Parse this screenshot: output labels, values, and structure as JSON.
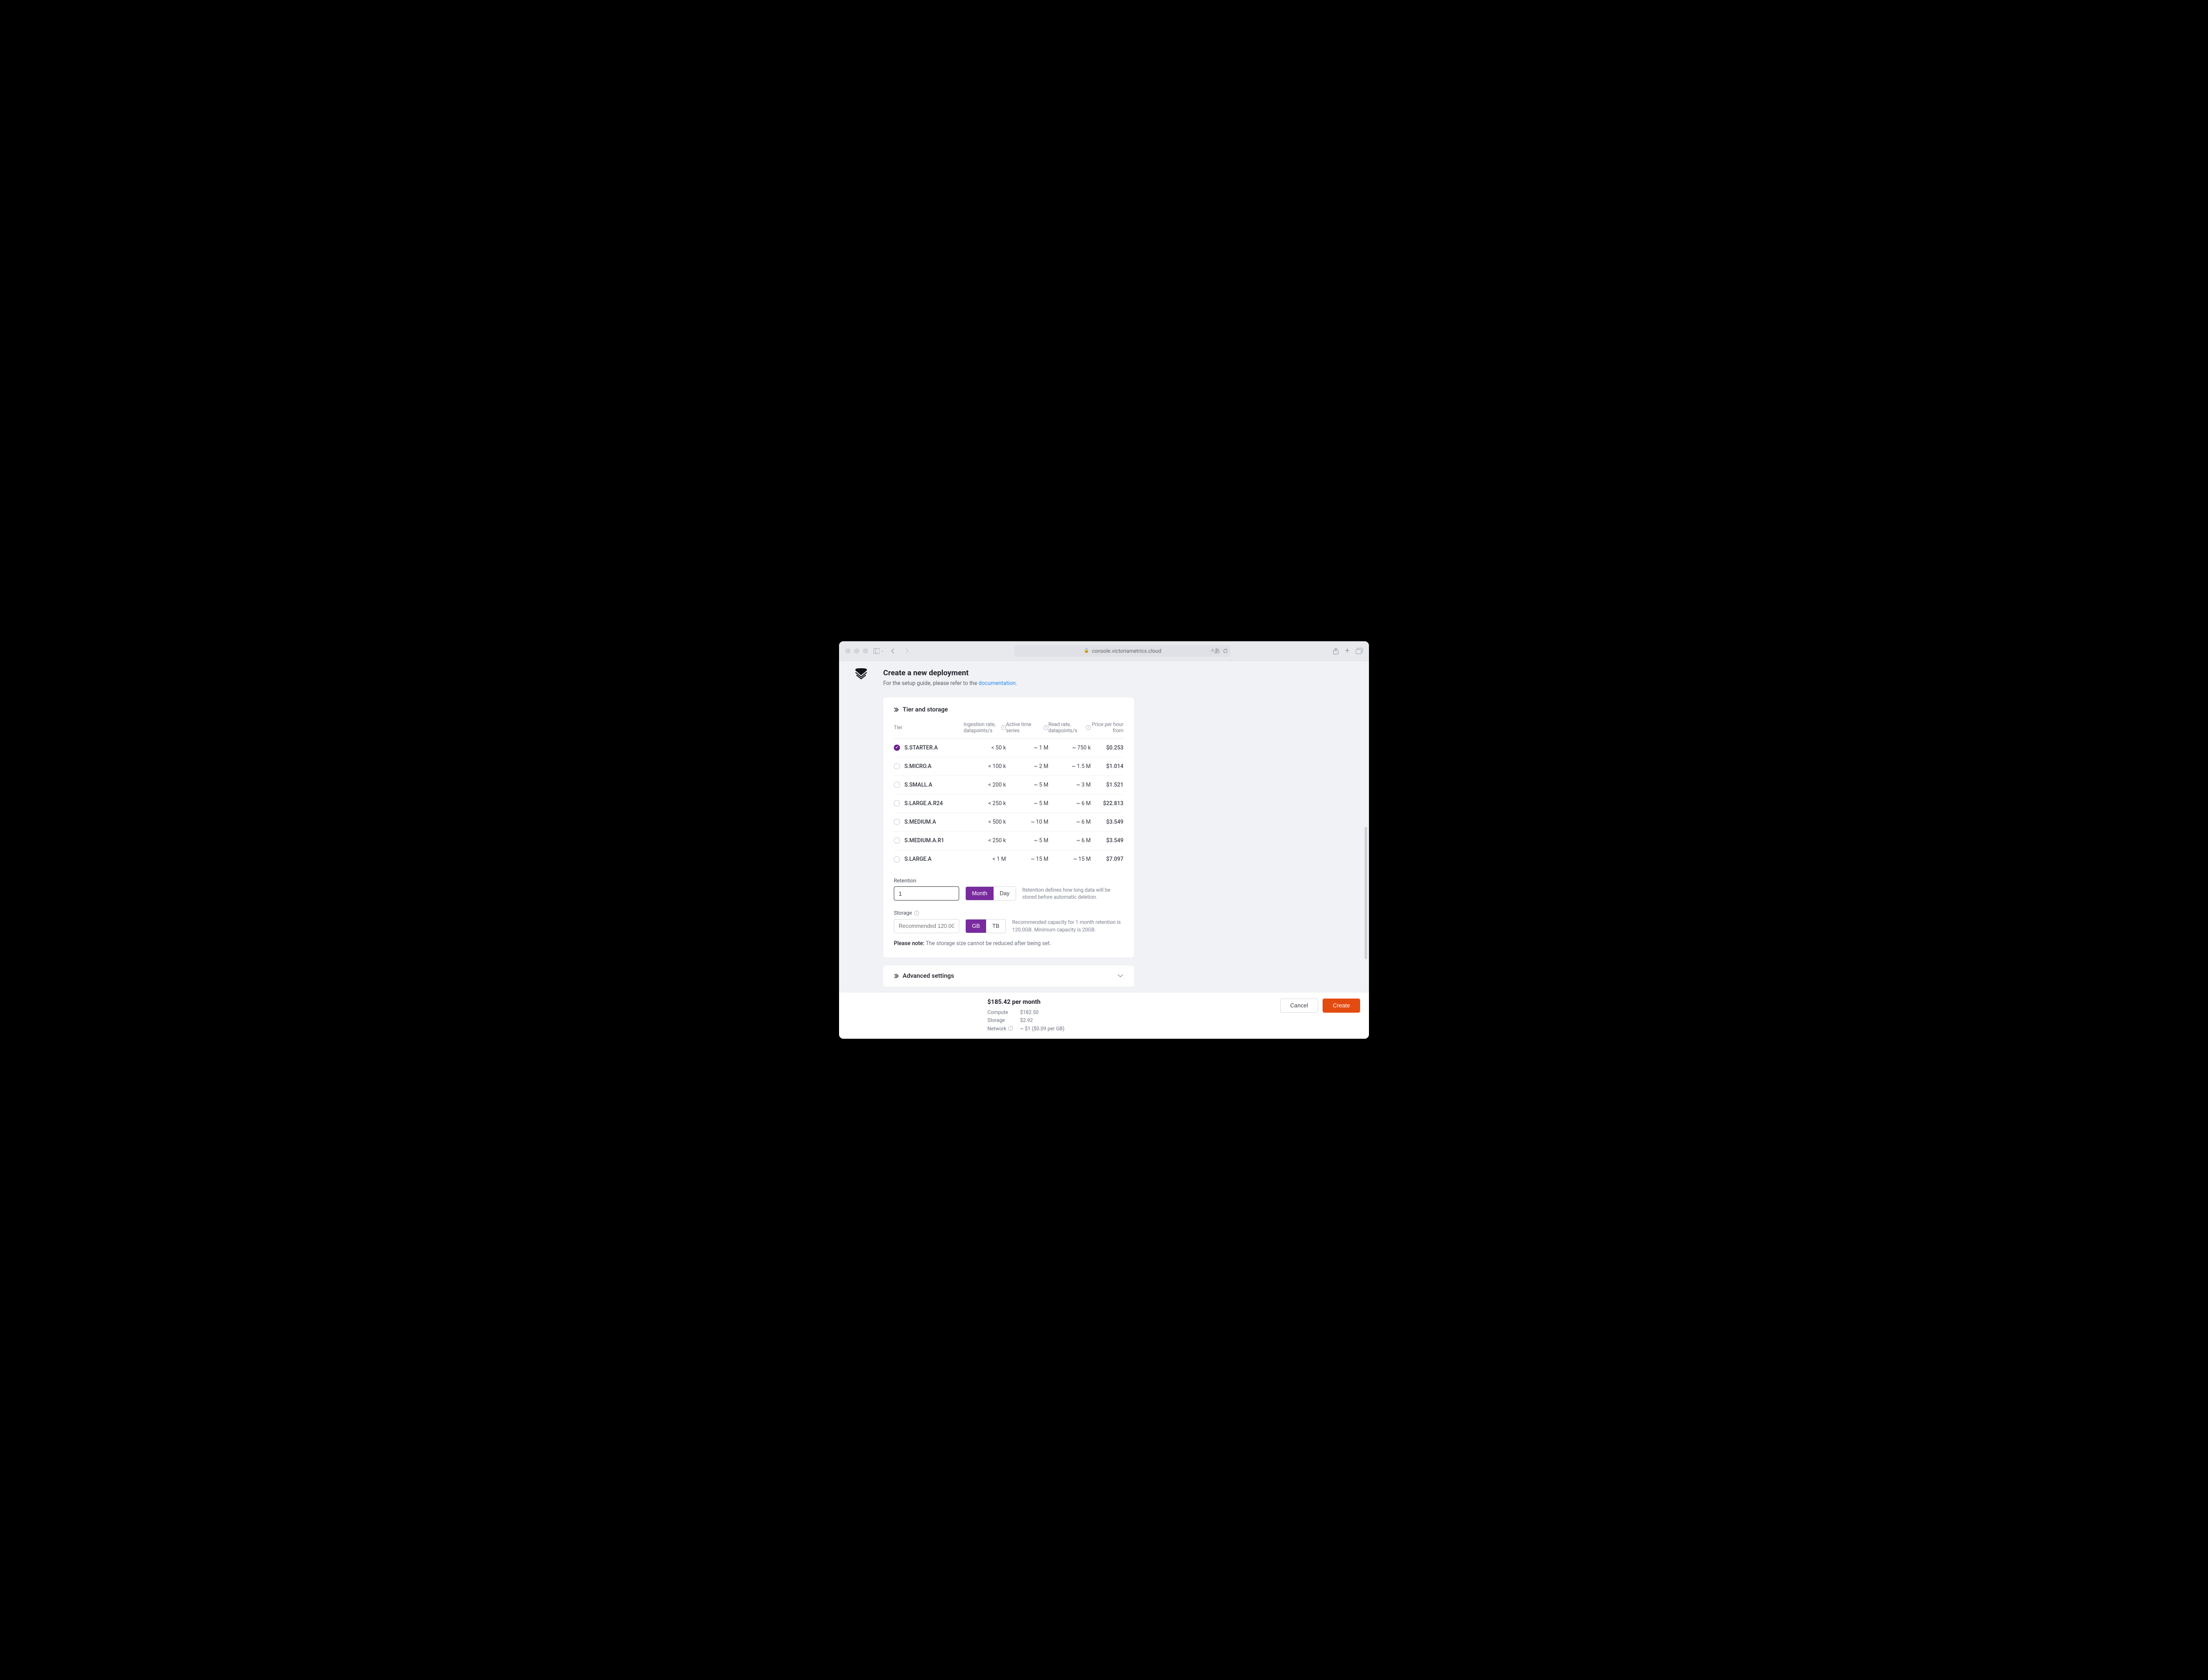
{
  "browser": {
    "url": "console.victoriametrics.cloud"
  },
  "header": {
    "title": "Create a new deployment",
    "subtitle_prefix": "For the setup guide, please refer to the ",
    "doc_link": "documentation",
    "subtitle_suffix": "."
  },
  "tier_section": {
    "heading": "Tier and storage",
    "columns": {
      "tier": "Tier",
      "ingestion": "Ingestion rate, datapoints/s",
      "active": "Active time series",
      "read": "Read rate, datapoints/s",
      "price": "Price per hour from"
    },
    "rows": [
      {
        "selected": true,
        "name": "S.STARTER.A",
        "ingestion": "< 50 k",
        "active": "~ 1 M",
        "read": "~ 750 k",
        "price": "$0.253"
      },
      {
        "selected": false,
        "name": "S.MICRO.A",
        "ingestion": "< 100 k",
        "active": "~ 2 M",
        "read": "~ 1.5 M",
        "price": "$1.014"
      },
      {
        "selected": false,
        "name": "S.SMALL.A",
        "ingestion": "< 200 k",
        "active": "~ 5 M",
        "read": "~ 3 M",
        "price": "$1.521"
      },
      {
        "selected": false,
        "name": "S.LARGE.A.R24",
        "ingestion": "< 250 k",
        "active": "~ 5 M",
        "read": "~ 6 M",
        "price": "$22.813"
      },
      {
        "selected": false,
        "name": "S.MEDIUM.A",
        "ingestion": "< 500 k",
        "active": "~ 10 M",
        "read": "~ 6 M",
        "price": "$3.549"
      },
      {
        "selected": false,
        "name": "S.MEDIUM.A.R1",
        "ingestion": "< 250 k",
        "active": "~ 5 M",
        "read": "~ 6 M",
        "price": "$3.549"
      },
      {
        "selected": false,
        "name": "S.LARGE.A",
        "ingestion": "< 1 M",
        "active": "~ 15 M",
        "read": "~ 15 M",
        "price": "$7.097"
      }
    ]
  },
  "retention": {
    "label": "Retention",
    "value": "1",
    "unit_month": "Month",
    "unit_day": "Day",
    "help": "Retention defines how long data will be stored before automatic deletion."
  },
  "storage": {
    "label": "Storage",
    "placeholder": "Recommended 120.0GB",
    "unit_gb": "GB",
    "unit_tb": "TB",
    "help": "Recommended capacity for 1 month retention is 120.0GB. Minimum capacity is 20GB."
  },
  "note": {
    "prefix": "Please note:",
    "text": " The storage size cannot be reduced after being set."
  },
  "advanced": {
    "heading": "Advanced settings"
  },
  "footer": {
    "total": "$185.42 per month",
    "lines": {
      "compute_k": "Compute",
      "compute_v": "$182.50",
      "storage_k": "Storage",
      "storage_v": "$2.92",
      "network_k": "Network",
      "network_v": "~ $1 ($0.09 per GB)"
    },
    "cancel": "Cancel",
    "create": "Create"
  }
}
